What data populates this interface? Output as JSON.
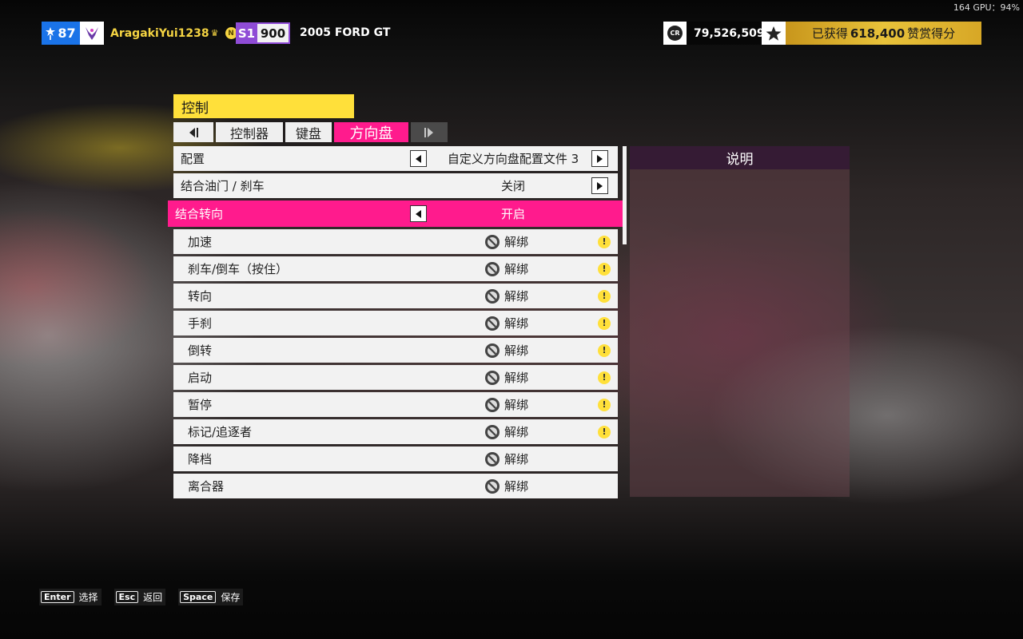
{
  "system": {
    "gpu_readout": "164 GPU：94%"
  },
  "hud": {
    "level": "87",
    "gamertag": "AragakiYui1238",
    "crown_glyph": "♛",
    "badge_letter": "N",
    "car_class": "S1",
    "performance_index": "900",
    "car_name": "2005 FORD GT",
    "credits_icon_label": "CR",
    "credits": "79,526,509",
    "accolade_prefix": "已获得",
    "accolade_points": "618,400",
    "accolade_suffix": "赞赏得分"
  },
  "panel": {
    "title": "控制",
    "tabs": [
      {
        "label": "控制器",
        "active": false
      },
      {
        "label": "键盘",
        "active": false
      },
      {
        "label": "方向盘",
        "active": true
      }
    ]
  },
  "settings": [
    {
      "label": "配置",
      "value": "自定义方向盘配置文件 3",
      "has_left_arrow": true,
      "has_right_arrow": true
    },
    {
      "label": "结合油门 / 刹车",
      "value": "关闭",
      "has_left_arrow": false,
      "has_right_arrow": true
    },
    {
      "label": "结合转向",
      "value": "开启",
      "has_left_arrow": true,
      "has_right_arrow": false,
      "selected": true
    }
  ],
  "bindings": [
    {
      "label": "加速",
      "status": "解绑",
      "warning": true
    },
    {
      "label": "刹车/倒车（按住）",
      "status": "解绑",
      "warning": true
    },
    {
      "label": "转向",
      "status": "解绑",
      "warning": true
    },
    {
      "label": "手刹",
      "status": "解绑",
      "warning": true
    },
    {
      "label": "倒转",
      "status": "解绑",
      "warning": true
    },
    {
      "label": "启动",
      "status": "解绑",
      "warning": true
    },
    {
      "label": "暂停",
      "status": "解绑",
      "warning": true
    },
    {
      "label": "标记/追逐者",
      "status": "解绑",
      "warning": true
    },
    {
      "label": "降档",
      "status": "解绑",
      "warning": false
    },
    {
      "label": "离合器",
      "status": "解绑",
      "warning": false
    }
  ],
  "warning_glyph": "!",
  "description": {
    "title": "说明"
  },
  "hints": [
    {
      "key": "Enter",
      "label": "选择"
    },
    {
      "key": "Esc",
      "label": "返回"
    },
    {
      "key": "Space",
      "label": "保存"
    }
  ],
  "colors": {
    "accent_pink": "#ff1b8d",
    "title_yellow": "#ffe03a",
    "level_blue": "#1a73e8",
    "class_purple": "#8f4cd6",
    "gold": "#e8c23a"
  }
}
